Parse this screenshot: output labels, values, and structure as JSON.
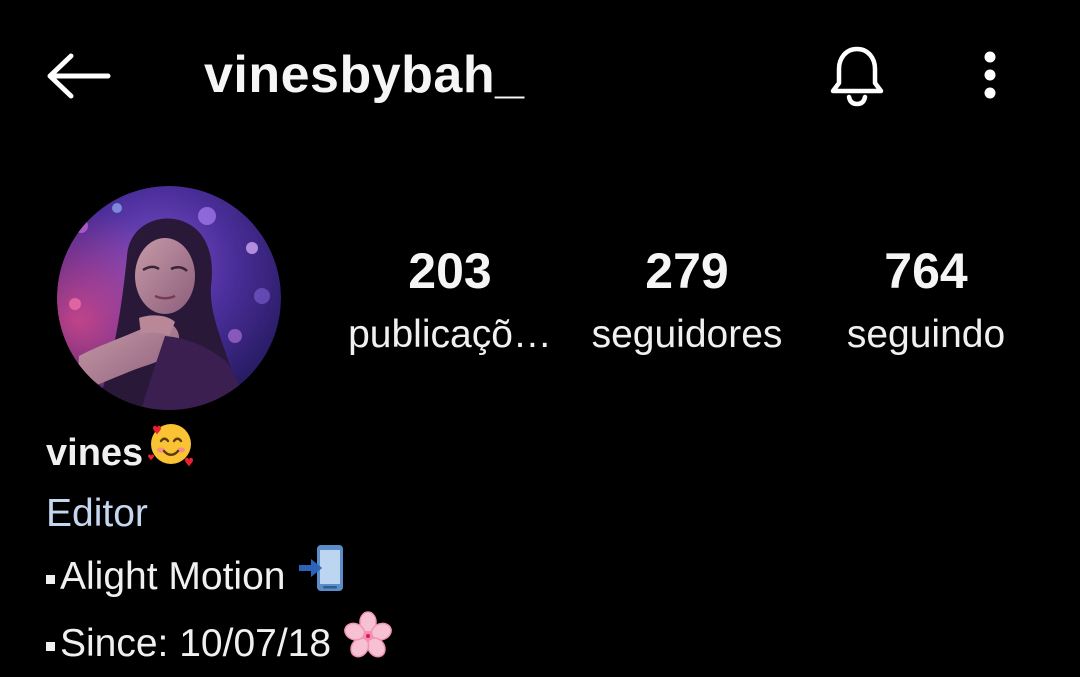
{
  "header": {
    "username": "vinesbybah_",
    "back_icon": "arrow-left-icon",
    "bell_icon": "bell-icon",
    "more_icon": "more-vertical-icon"
  },
  "profile": {
    "avatar_icon": "profile-photo",
    "stats": [
      {
        "count": "203",
        "label": "publicaçõ…"
      },
      {
        "count": "279",
        "label": "seguidores"
      },
      {
        "count": "764",
        "label": "seguindo"
      }
    ]
  },
  "bio": {
    "name": "vines",
    "name_emoji": "smiling-face-with-hearts",
    "category": "Editor",
    "lines": [
      {
        "text": "Alight Motion",
        "emoji": "mobile-phone-with-arrow"
      },
      {
        "text": "Since: 10/07/18",
        "emoji": "cherry-blossom"
      }
    ]
  },
  "colors": {
    "background": "#000000",
    "text": "#ffffff",
    "category_text": "#c4d7ef"
  }
}
